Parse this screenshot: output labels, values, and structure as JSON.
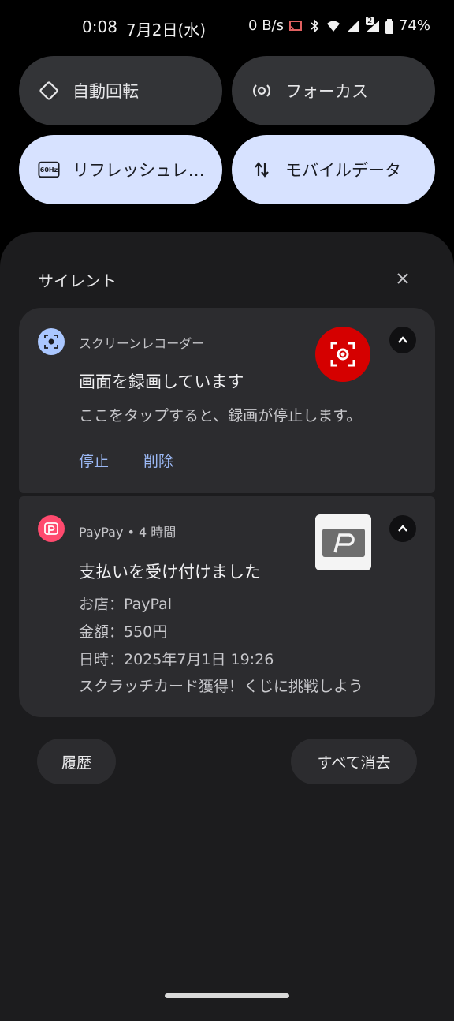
{
  "status_bar": {
    "time": "0:08",
    "date": "7月2日(水)",
    "net_speed": "0 B/s",
    "signal_badge": "2",
    "battery": "74%",
    "icons": [
      "cast-icon",
      "bluetooth-icon",
      "wifi-icon",
      "signal-icon",
      "signal-2-icon",
      "battery-icon"
    ]
  },
  "quick_tiles": [
    {
      "label": "自動回転",
      "icon": "auto-rotate-icon",
      "active": false
    },
    {
      "label": "フォーカス",
      "icon": "focus-icon",
      "active": false
    },
    {
      "label": "リフレッシュレ…",
      "icon": "refresh-rate-icon",
      "icon_text": "60Hz",
      "active": true
    },
    {
      "label": "モバイルデータ",
      "icon": "mobile-data-icon",
      "active": true
    }
  ],
  "section": {
    "title": "サイレント",
    "close_icon": "close-icon"
  },
  "notifications": [
    {
      "app": "スクリーンレコーダー",
      "app_icon": "screen-recorder-icon",
      "title": "画面を録画しています",
      "text": "ここをタップすると、録画が停止します。",
      "actions": [
        "停止",
        "削除"
      ],
      "badge_icon": "record-icon",
      "badge_color": "#d50000"
    },
    {
      "app": "PayPay",
      "time": "4 時間",
      "app_icon": "paypay-icon",
      "title": "支払いを受け付けました",
      "lines": [
        "お店：PayPal",
        "金額：550円",
        "日時：2025年7月1日 19:26",
        "スクラッチカード獲得！くじに挑戦しよう"
      ],
      "thumbnail_icon": "paypay-card-icon"
    }
  ],
  "footer": {
    "history_label": "履歴",
    "clear_all_label": "すべて消去"
  },
  "colors": {
    "accent": "#9bb8f4",
    "tile_active": "#d7e2ff",
    "tile_inactive": "#333437",
    "paypay": "#ff4a6e"
  }
}
